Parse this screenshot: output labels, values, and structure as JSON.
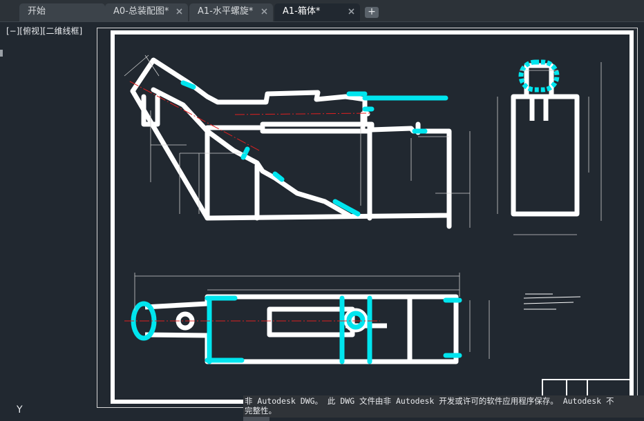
{
  "tabs": [
    {
      "label": "开始",
      "active": false,
      "closable": false
    },
    {
      "label": "A0-总装配图*",
      "active": false,
      "closable": true
    },
    {
      "label": "A1-水平螺旋*",
      "active": false,
      "closable": true
    },
    {
      "label": "A1-箱体*",
      "active": true,
      "closable": true
    }
  ],
  "new_tab_icon": "plus-icon",
  "viewport": {
    "label": "[−][俯视][二维线框]"
  },
  "ucs_axis": "Y",
  "notice": {
    "line1": "非 Autodesk DWG。 此 DWG 文件由非 Autodesk 开发或许可的软件应用程序保存。 Autodesk 不",
    "line2": "完整性。"
  },
  "colors": {
    "background": "#212830",
    "drawing_line": "#ffffff",
    "highlight": "#00e5ee",
    "centerline": "#e02020"
  }
}
